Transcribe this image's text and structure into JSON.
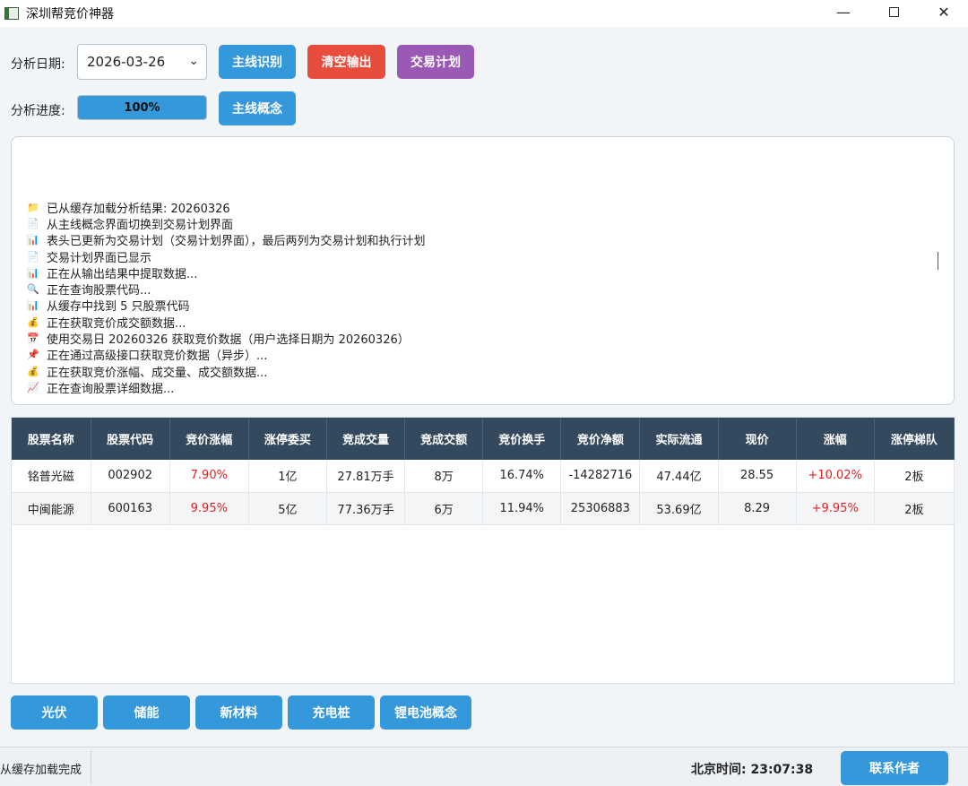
{
  "window": {
    "title": "深圳帮竞价神器",
    "minimize_glyph": "—",
    "close_glyph": "✕"
  },
  "controls": {
    "date_label": "分析日期:",
    "date_value": "2026-03-26",
    "progress_label": "分析进度:",
    "progress_text": "100%",
    "progress_fraction": 1.0,
    "buttons": {
      "mainline_identify": "主线识别",
      "clear_output": "清空输出",
      "trade_plan": "交易计划",
      "mainline_concept": "主线概念"
    }
  },
  "colors": {
    "blue": "#3498db",
    "red": "#e74c3c",
    "purple": "#9b59b6",
    "header_bg": "#34495e",
    "rise_red": "#e41e1e"
  },
  "log": {
    "lines": [
      {
        "icon": "folder-icon",
        "text": "已从缓存加载分析结果: 20260326"
      },
      {
        "icon": "memo-icon",
        "text": "从主线概念界面切换到交易计划界面"
      },
      {
        "icon": "bar-chart-icon",
        "text": "表头已更新为交易计划（交易计划界面），最后两列为交易计划和执行计划"
      },
      {
        "icon": "memo-icon",
        "text": "交易计划界面已显示"
      },
      {
        "icon": "bar-chart-icon",
        "text": "正在从输出结果中提取数据..."
      },
      {
        "icon": "magnifier-icon",
        "text": "正在查询股票代码..."
      },
      {
        "icon": "bar-chart-icon",
        "text": "从缓存中找到 5 只股票代码"
      },
      {
        "icon": "money-bag-icon",
        "text": "正在获取竞价成交额数据..."
      },
      {
        "icon": "calendar-icon",
        "text": "使用交易日 20260326 获取竞价数据（用户选择日期为 20260326）"
      },
      {
        "icon": "pushpin-icon",
        "text": "正在通过高级接口获取竞价数据（异步）..."
      },
      {
        "icon": "money-bag-icon",
        "text": "正在获取竞价涨幅、成交量、成交额数据..."
      },
      {
        "icon": "line-chart-icon",
        "text": "正在查询股票详细数据..."
      }
    ]
  },
  "table": {
    "headers": [
      "股票名称",
      "股票代码",
      "竞价涨幅",
      "涨停委买",
      "竞成交量",
      "竞成交额",
      "竞价换手",
      "竞价净额",
      "实际流通",
      "现价",
      "涨幅",
      "涨停梯队"
    ],
    "rows": [
      [
        "铭普光磁",
        "002902",
        "7.90%",
        "1亿",
        "27.81万手",
        "8万",
        "16.74%",
        "-14282716",
        "47.44亿",
        "28.55",
        "+10.02%",
        "2板"
      ],
      [
        "中闽能源",
        "600163",
        "9.95%",
        "5亿",
        "77.36万手",
        "6万",
        "11.94%",
        "25306883",
        "53.69亿",
        "8.29",
        "+9.95%",
        "2板"
      ]
    ]
  },
  "concepts": [
    "光伏",
    "储能",
    "新材料",
    "充电桩",
    "锂电池概念"
  ],
  "status": {
    "message": "从缓存加载完成",
    "clock": "北京时间: 23:07:38",
    "contact": "联系作者"
  }
}
